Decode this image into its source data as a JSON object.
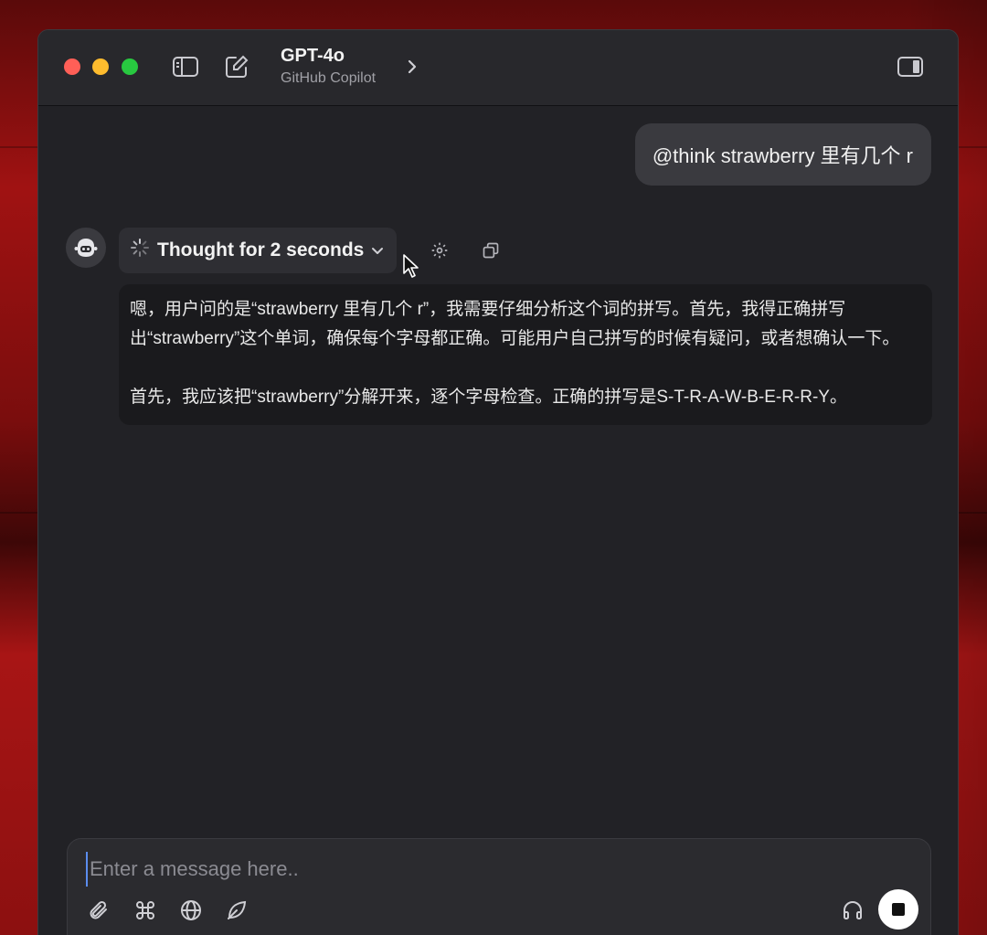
{
  "window": {
    "model_title": "GPT-4o",
    "model_subtitle": "GitHub Copilot"
  },
  "titlebar_icons": [
    "sidebar-toggle-icon",
    "compose-icon",
    "chevron-right-icon",
    "right-panel-icon"
  ],
  "conversation": {
    "user_message": "@think strawberry 里有几个 r",
    "assistant": {
      "avatar_icon": "copilot-bot-icon",
      "thought_label": "Thought for 2 seconds",
      "thinking_paragraphs": [
        "嗯，用户问的是“strawberry 里有几个 r”，我需要仔细分析这个词的拼写。首先，我得正确拼写出“strawberry”这个单词，确保每个字母都正确。可能用户自己拼写的时候有疑问，或者想确认一下。",
        "首先，我应该把“strawberry”分解开来，逐个字母检查。正确的拼写是S-T-R-A-W-B-E-R-R-Y。"
      ]
    }
  },
  "composer": {
    "placeholder": "Enter a message here..",
    "tools": [
      "paperclip-icon",
      "command-icon",
      "globe-icon",
      "leaf-icon"
    ],
    "right_tools": [
      "headphones-icon",
      "stop-icon"
    ]
  },
  "colors": {
    "window_bg": "#222226",
    "bubble_bg": "#3a3a3f",
    "thinking_bg": "#1a1a1d",
    "accent_caret": "#5b8def"
  }
}
